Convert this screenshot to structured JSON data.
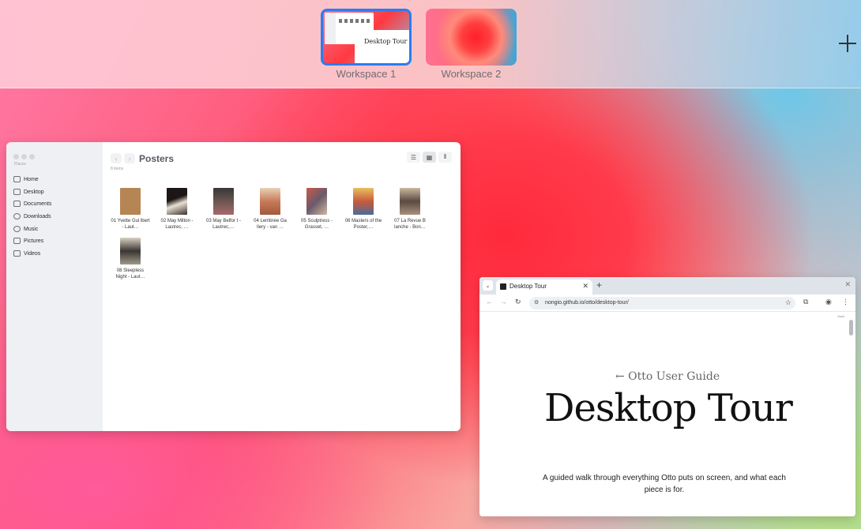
{
  "workspaces": [
    {
      "label": "Workspace 1",
      "active": true,
      "mini_title": "Desktop Tour"
    },
    {
      "label": "Workspace 2",
      "active": false
    }
  ],
  "file_manager": {
    "sidebar_header": "Places",
    "sidebar_items": [
      {
        "label": "Home",
        "icon": "home-icon"
      },
      {
        "label": "Desktop",
        "icon": "desktop-icon"
      },
      {
        "label": "Documents",
        "icon": "documents-icon"
      },
      {
        "label": "Downloads",
        "icon": "downloads-icon"
      },
      {
        "label": "Music",
        "icon": "music-icon"
      },
      {
        "label": "Pictures",
        "icon": "pictures-icon"
      },
      {
        "label": "Videos",
        "icon": "videos-icon"
      }
    ],
    "title": "Posters",
    "item_count": "8 items",
    "files": [
      {
        "name": "01 Yvette Gui lbert - Laut…",
        "color": "#b58553"
      },
      {
        "name": "02 May Milton - Lautrec, …",
        "color": "#3a2f2c"
      },
      {
        "name": "03 May Belfor t - Lautrec,…",
        "color": "#5a4f4c"
      },
      {
        "name": "04 Lembree Ga llery - van …",
        "color": "#c89a72"
      },
      {
        "name": "05 Sculptress - Grasset, …",
        "color": "#7a5a52"
      },
      {
        "name": "06 Masters of the Poster,…",
        "color": "#d6a050"
      },
      {
        "name": "07 La Revue B lanche - Bon…",
        "color": "#8a7a6a"
      },
      {
        "name": "08 Sleepless Night - Laut…",
        "color": "#5a5550"
      }
    ]
  },
  "browser": {
    "tab_title": "Desktop Tour",
    "url": "nongio.github.io/otto/desktop-tour/",
    "page": {
      "back_link": "← Otto User Guide",
      "heading": "Desktop Tour",
      "lead": "A guided walk through everything Otto puts on screen, and what each piece is for.",
      "dark_toggle": "Dark"
    }
  }
}
